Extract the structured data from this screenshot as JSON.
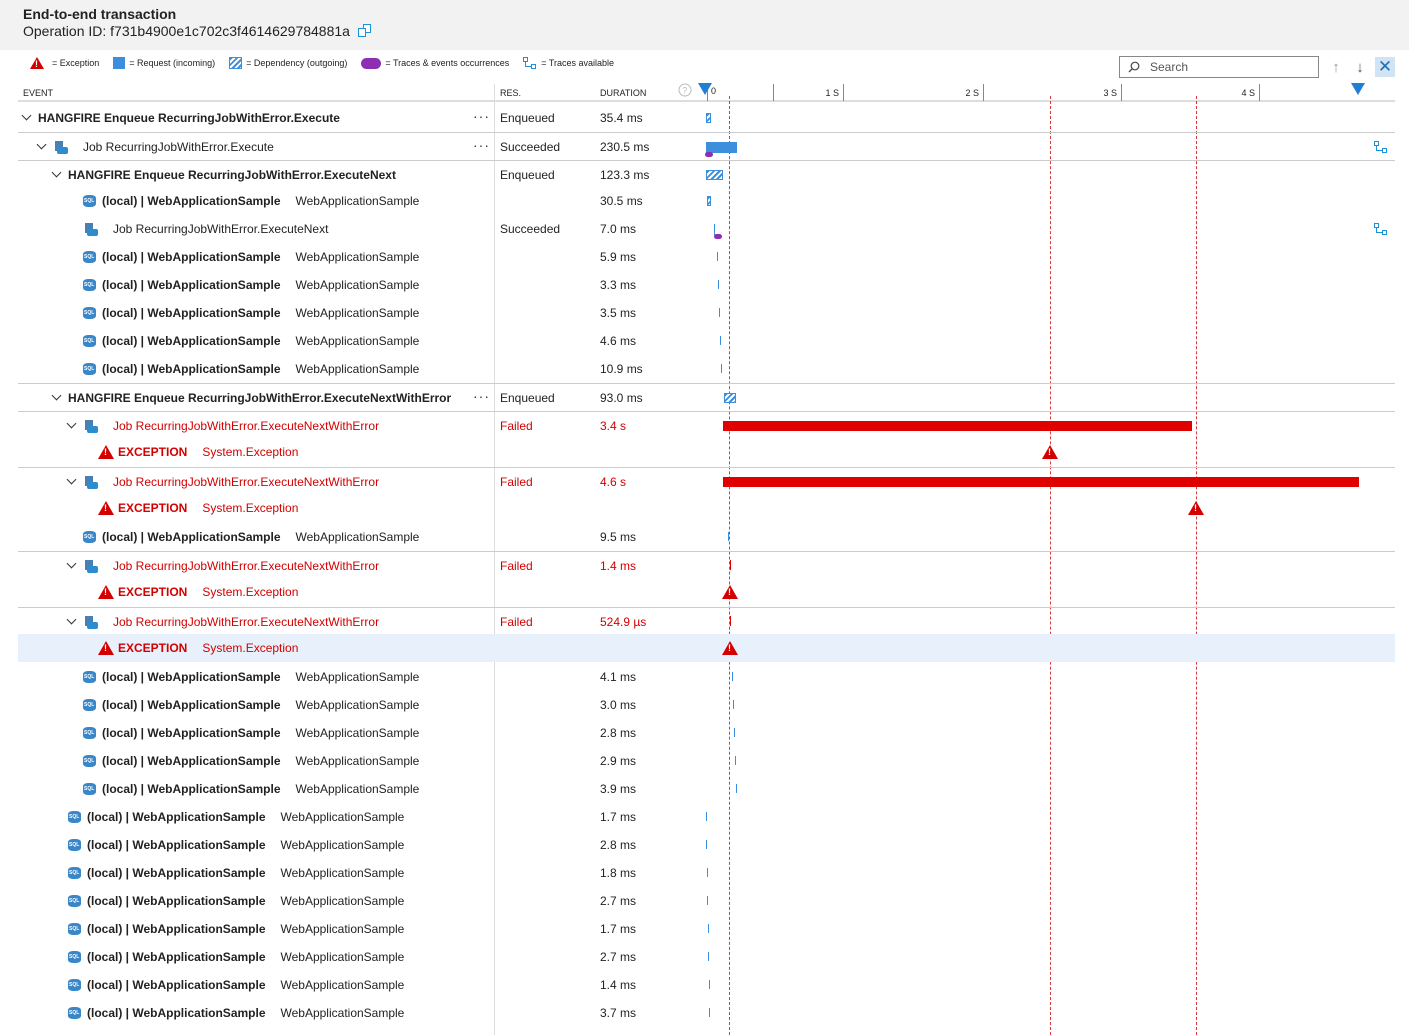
{
  "header": {
    "title": "End-to-end transaction",
    "operation_prefix": "Operation ID: ",
    "operation_id": "f731b4900e1c702c3f4614629784881a"
  },
  "legend": {
    "exception": "= Exception",
    "request": "= Request (incoming)",
    "dependency": "= Dependency (outgoing)",
    "traces_events": "= Traces & events occurrences",
    "traces_available": "= Traces available"
  },
  "search": {
    "placeholder": "Search"
  },
  "columns": {
    "event": "EVENT",
    "res": "RES.",
    "duration": "DURATION"
  },
  "timeline_ticks": [
    "0",
    "1 S",
    "2 S",
    "3 S",
    "4 S"
  ],
  "colors": {
    "request": "#3b8fdc",
    "failed": "#e00000",
    "trace": "#8c2fb3",
    "error_text": "#d40000"
  },
  "rows": [
    {
      "name": "HANGFIRE Enqueue RecurringJobWithError.Execute",
      "detail": "",
      "res": "Enqueued",
      "duration": "35.4 ms"
    },
    {
      "name": "Job RecurringJobWithError.Execute",
      "detail": "",
      "res": "Succeeded",
      "duration": "230.5 ms"
    },
    {
      "name": "HANGFIRE Enqueue RecurringJobWithError.ExecuteNext",
      "detail": "",
      "res": "Enqueued",
      "duration": "123.3 ms"
    },
    {
      "name": "(local) | WebApplicationSample",
      "detail": "WebApplicationSample",
      "res": "",
      "duration": "30.5 ms"
    },
    {
      "name": "Job RecurringJobWithError.ExecuteNext",
      "detail": "",
      "res": "Succeeded",
      "duration": "7.0 ms"
    },
    {
      "name": "(local) | WebApplicationSample",
      "detail": "WebApplicationSample",
      "res": "",
      "duration": "5.9 ms"
    },
    {
      "name": "(local) | WebApplicationSample",
      "detail": "WebApplicationSample",
      "res": "",
      "duration": "3.3 ms"
    },
    {
      "name": "(local) | WebApplicationSample",
      "detail": "WebApplicationSample",
      "res": "",
      "duration": "3.5 ms"
    },
    {
      "name": "(local) | WebApplicationSample",
      "detail": "WebApplicationSample",
      "res": "",
      "duration": "4.6 ms"
    },
    {
      "name": "(local) | WebApplicationSample",
      "detail": "WebApplicationSample",
      "res": "",
      "duration": "10.9 ms"
    },
    {
      "name": "HANGFIRE Enqueue RecurringJobWithError.ExecuteNextWithError",
      "detail": "",
      "res": "Enqueued",
      "duration": "93.0 ms"
    },
    {
      "name": "Job RecurringJobWithError.ExecuteNextWithError",
      "detail": "",
      "res": "Failed",
      "duration": "3.4 s"
    },
    {
      "name": "EXCEPTION",
      "detail": "System.Exception",
      "res": "",
      "duration": ""
    },
    {
      "name": "Job RecurringJobWithError.ExecuteNextWithError",
      "detail": "",
      "res": "Failed",
      "duration": "4.6 s"
    },
    {
      "name": "EXCEPTION",
      "detail": "System.Exception",
      "res": "",
      "duration": ""
    },
    {
      "name": "(local) | WebApplicationSample",
      "detail": "WebApplicationSample",
      "res": "",
      "duration": "9.5 ms"
    },
    {
      "name": "Job RecurringJobWithError.ExecuteNextWithError",
      "detail": "",
      "res": "Failed",
      "duration": "1.4 ms"
    },
    {
      "name": "EXCEPTION",
      "detail": "System.Exception",
      "res": "",
      "duration": ""
    },
    {
      "name": "Job RecurringJobWithError.ExecuteNextWithError",
      "detail": "",
      "res": "Failed",
      "duration": "524.9 µs"
    },
    {
      "name": "EXCEPTION",
      "detail": "System.Exception",
      "res": "",
      "duration": ""
    },
    {
      "name": "(local) | WebApplicationSample",
      "detail": "WebApplicationSample",
      "res": "",
      "duration": "4.1 ms"
    },
    {
      "name": "(local) | WebApplicationSample",
      "detail": "WebApplicationSample",
      "res": "",
      "duration": "3.0 ms"
    },
    {
      "name": "(local) | WebApplicationSample",
      "detail": "WebApplicationSample",
      "res": "",
      "duration": "2.8 ms"
    },
    {
      "name": "(local) | WebApplicationSample",
      "detail": "WebApplicationSample",
      "res": "",
      "duration": "2.9 ms"
    },
    {
      "name": "(local) | WebApplicationSample",
      "detail": "WebApplicationSample",
      "res": "",
      "duration": "3.9 ms"
    },
    {
      "name": "(local) | WebApplicationSample",
      "detail": "WebApplicationSample",
      "res": "",
      "duration": "1.7 ms"
    },
    {
      "name": "(local) | WebApplicationSample",
      "detail": "WebApplicationSample",
      "res": "",
      "duration": "2.8 ms"
    },
    {
      "name": "(local) | WebApplicationSample",
      "detail": "WebApplicationSample",
      "res": "",
      "duration": "1.8 ms"
    },
    {
      "name": "(local) | WebApplicationSample",
      "detail": "WebApplicationSample",
      "res": "",
      "duration": "2.7 ms"
    },
    {
      "name": "(local) | WebApplicationSample",
      "detail": "WebApplicationSample",
      "res": "",
      "duration": "1.7 ms"
    },
    {
      "name": "(local) | WebApplicationSample",
      "detail": "WebApplicationSample",
      "res": "",
      "duration": "2.7 ms"
    },
    {
      "name": "(local) | WebApplicationSample",
      "detail": "WebApplicationSample",
      "res": "",
      "duration": "1.4 ms"
    },
    {
      "name": "(local) | WebApplicationSample",
      "detail": "WebApplicationSample",
      "res": "",
      "duration": "3.7 ms"
    }
  ]
}
